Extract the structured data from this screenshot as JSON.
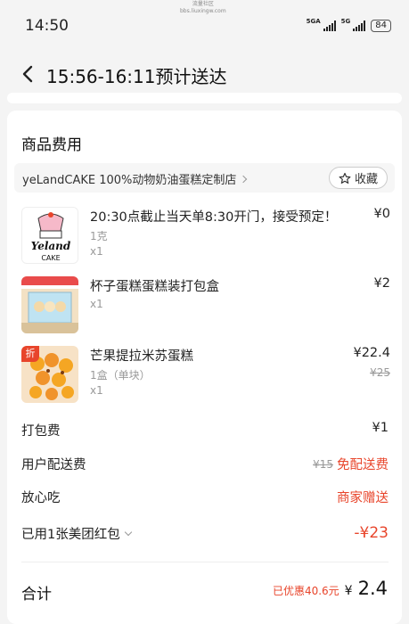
{
  "status_bar": {
    "time": "14:50",
    "network": "5GA",
    "network2": "5G",
    "battery": "84",
    "watermark_line1": "流量社区",
    "watermark_line2": "bbs.liuxingw.com"
  },
  "header": {
    "title": "15:56-16:11预计送达"
  },
  "section": {
    "title": "商品费用"
  },
  "store": {
    "name": "yeLandCAKE 100%动物奶油蛋糕定制店",
    "fav_label": "收藏"
  },
  "logo": {
    "text": "Yeland",
    "subtext": "CAKE"
  },
  "items": [
    {
      "name": "20:30点截止当天单8:30开门，接受预定！",
      "spec": "1克",
      "qty": "x1",
      "price": "¥0",
      "original_price": ""
    },
    {
      "name": "杯子蛋糕蛋糕装打包盒",
      "spec": "",
      "qty": "x1",
      "price": "¥2",
      "original_price": ""
    },
    {
      "name": "芒果提拉米苏蛋糕",
      "spec": "1盒（单块）",
      "qty": "x1",
      "price": "¥22.4",
      "original_price": "¥25",
      "badge": "折"
    }
  ],
  "fees": {
    "packing": {
      "label": "打包费",
      "value": "¥1"
    },
    "delivery": {
      "label": "用户配送费",
      "original": "¥15",
      "value": "免配送费"
    },
    "worry_free": {
      "label": "放心吃",
      "value": "商家赠送"
    },
    "coupon": {
      "label": "已用1张美团红包",
      "value": "-¥23"
    }
  },
  "total": {
    "label": "合计",
    "discount": "已优惠40.6元",
    "currency": "¥",
    "value": "2.4"
  },
  "colors": {
    "accent": "#e8452b",
    "background": "#f4f4f4",
    "card": "#ffffff"
  }
}
